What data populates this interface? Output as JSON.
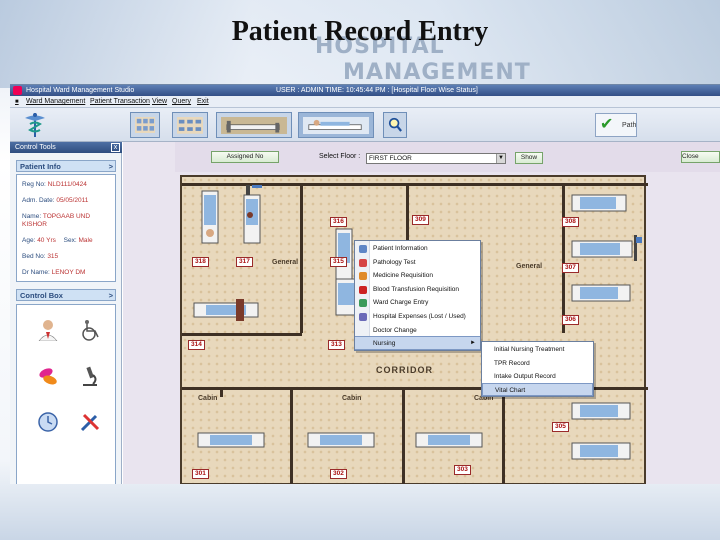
{
  "slide": {
    "title": "Patient Record Entry",
    "banner_hospital": "HOSPITAL",
    "banner_management": "MANAGEMENT"
  },
  "window": {
    "title": "Hospital Ward Management Studio",
    "status": "USER : ADMIN    TIME: 10:45:44 PM : [Hospital Floor Wise Status]"
  },
  "menu": [
    "Ward Management",
    "Patient Transaction",
    "View",
    "Query",
    "Exit"
  ],
  "toolbar": {
    "tick_label": "Path"
  },
  "left_panel": {
    "header": "Control Tools",
    "close": "x",
    "patient_info_title": "Patient Info",
    "chevron": ">",
    "fields": [
      {
        "label": "Reg No:",
        "value": "NLD111/0424"
      },
      {
        "label": "Adm. Date:",
        "value": "05/05/2011"
      },
      {
        "label": "Name:",
        "value": "TOPGAAB UND KISHOR"
      },
      {
        "label": "Age:",
        "value": "40 Yrs",
        "label2": "Sex:",
        "value2": "Male"
      },
      {
        "label": "Bed No:",
        "value": "315"
      },
      {
        "label": "Dr Name:",
        "value": "LENOY DM"
      }
    ],
    "control_box_title": "Control Box"
  },
  "content": {
    "assigned_button": "Assigned No",
    "select_floor_label": "Select Floor :",
    "floor_value": "FIRST FLOOR",
    "show_button": "Show",
    "close_window_button": "Close Window"
  },
  "floor_plan": {
    "rooms": [
      {
        "id": "318",
        "label": "318"
      },
      {
        "id": "317",
        "label": "317"
      },
      {
        "id": "316",
        "label": "316"
      },
      {
        "id": "315",
        "label": "315"
      },
      {
        "id": "309",
        "label": "309"
      },
      {
        "id": "308",
        "label": "308"
      },
      {
        "id": "307",
        "label": "307"
      },
      {
        "id": "306",
        "label": "306"
      },
      {
        "id": "314",
        "label": "314"
      },
      {
        "id": "313",
        "label": "313"
      },
      {
        "id": "305",
        "label": "305"
      },
      {
        "id": "304",
        "label": "304"
      },
      {
        "id": "301",
        "label": "301"
      },
      {
        "id": "302",
        "label": "302"
      },
      {
        "id": "303",
        "label": "303"
      }
    ],
    "general_left": "General",
    "general_right": "General",
    "corridor": "CORRIDOR",
    "cabin_1": "Cabin",
    "cabin_2": "Cabin",
    "cabin_3": "Cabin"
  },
  "context_menu": {
    "items": [
      "Patient Information",
      "Pathology Test",
      "Medicine Requisition",
      "Blood Transfusion Requisition",
      "Ward Charge Entry",
      "Hospital Expenses (Lost / Used)",
      "Doctor Change",
      "Nursing"
    ],
    "submenu_arrow": "►",
    "submenu": [
      "Initial Nursing Treatment",
      "TPR Record",
      "Intake Output Record",
      "Vital Chart"
    ]
  },
  "colors": {
    "accent": "#2f4d7f",
    "room_number": "#a11111",
    "plan_floor": "#e8d8bc",
    "menu_highlight": "#c6d6ee"
  }
}
